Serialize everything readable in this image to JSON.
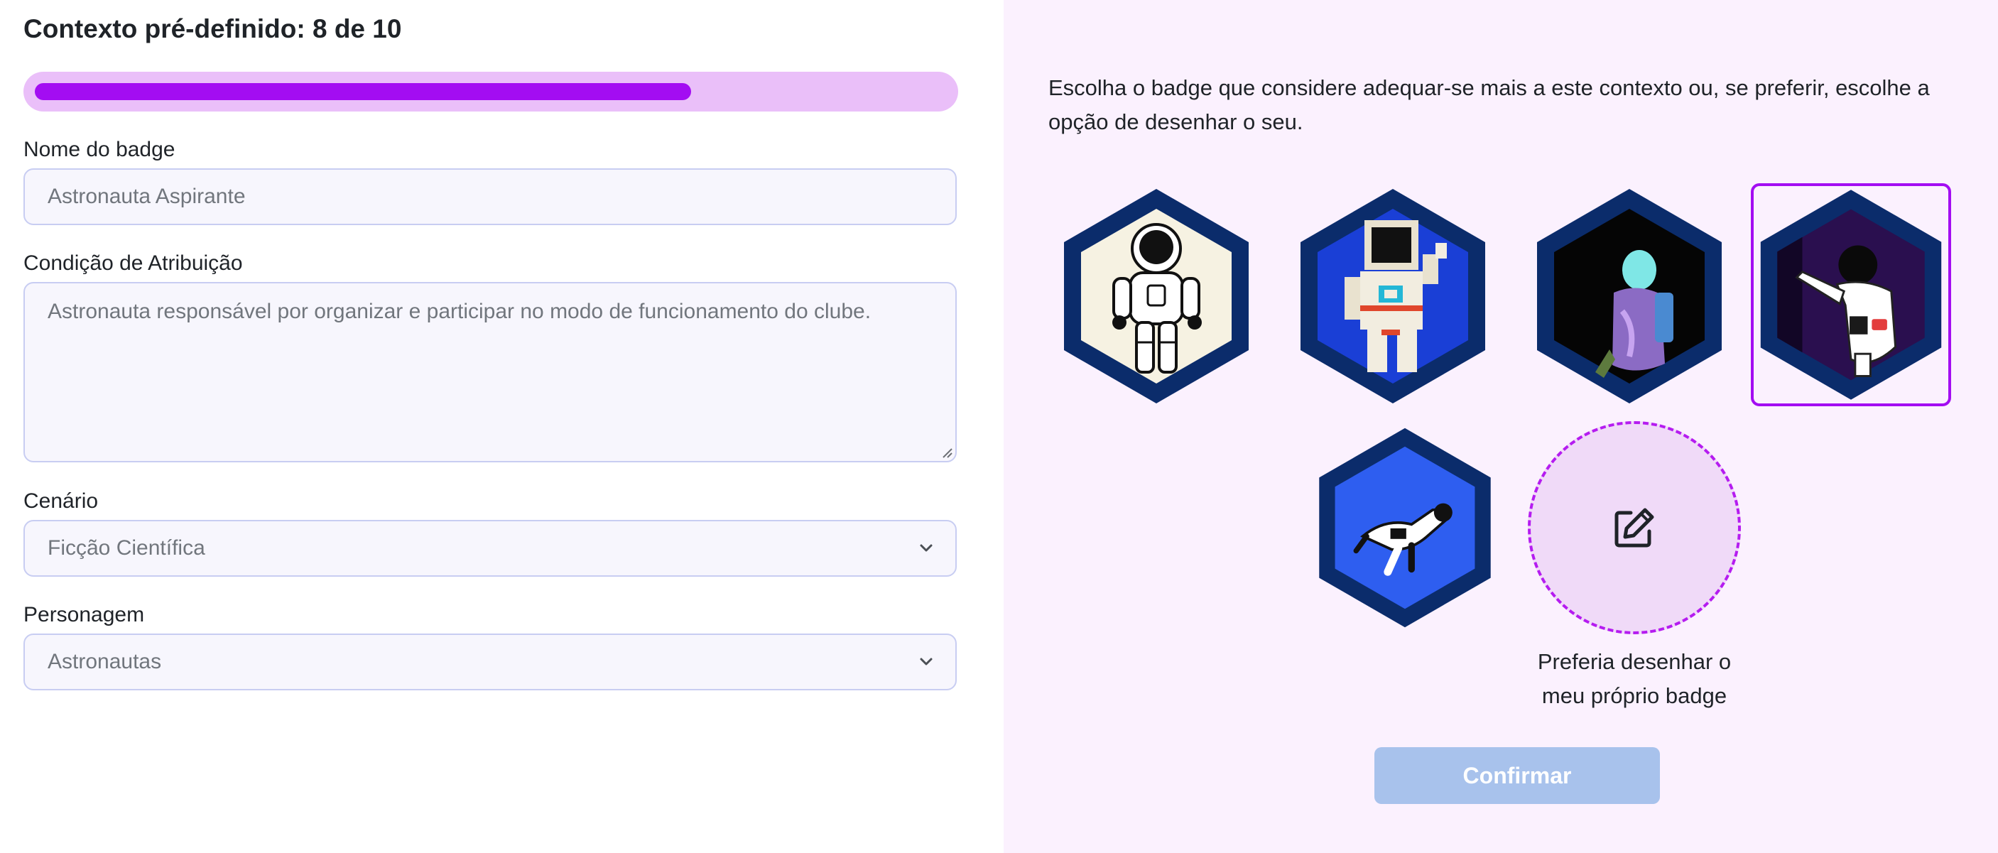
{
  "header": {
    "title": "Contexto pré-definido: 8 de 10",
    "progress_current": 8,
    "progress_total": 10,
    "progress_fraction": 0.72
  },
  "form": {
    "name_label": "Nome do badge",
    "name_value": "Astronauta Aspirante",
    "condition_label": "Condição de Atribuição",
    "condition_value": "Astronauta responsável por organizar e participar no modo de funcionamento do clube.",
    "scenario_label": "Cenário",
    "scenario_value": "Ficção Científica",
    "character_label": "Personagem",
    "character_value": "Astronautas"
  },
  "badge_picker": {
    "instructions": "Escolha o badge que considere adequar-se mais a este contexto ou, se preferir, escolhe a opção de desenhar o seu.",
    "selected_index": 3,
    "badges": [
      {
        "icon": "astronaut-standing-icon",
        "bg": "#f6f2e2",
        "frame": "#0b2c6b"
      },
      {
        "icon": "astronaut-pixel-waving-icon",
        "bg": "#1a3fd6",
        "frame": "#0b2c6b"
      },
      {
        "icon": "astronaut-walking-icon",
        "bg": "#050505",
        "frame": "#0b2c6b"
      },
      {
        "icon": "astronaut-pointing-icon",
        "bg": "#2a0f4f",
        "frame": "#0b2c6b"
      },
      {
        "icon": "astronaut-floating-icon",
        "bg": "#2e5ef0",
        "frame": "#0b2c6b"
      }
    ],
    "draw_option_caption": "Preferia desenhar o meu próprio badge",
    "draw_option_icon": "edit-icon",
    "confirm_label": "Confirmar"
  },
  "colors": {
    "accent": "#a30df2",
    "progress_track": "#eabff9",
    "right_panel_bg": "#fbf1fe",
    "confirm_disabled": "#a8c2ec"
  }
}
